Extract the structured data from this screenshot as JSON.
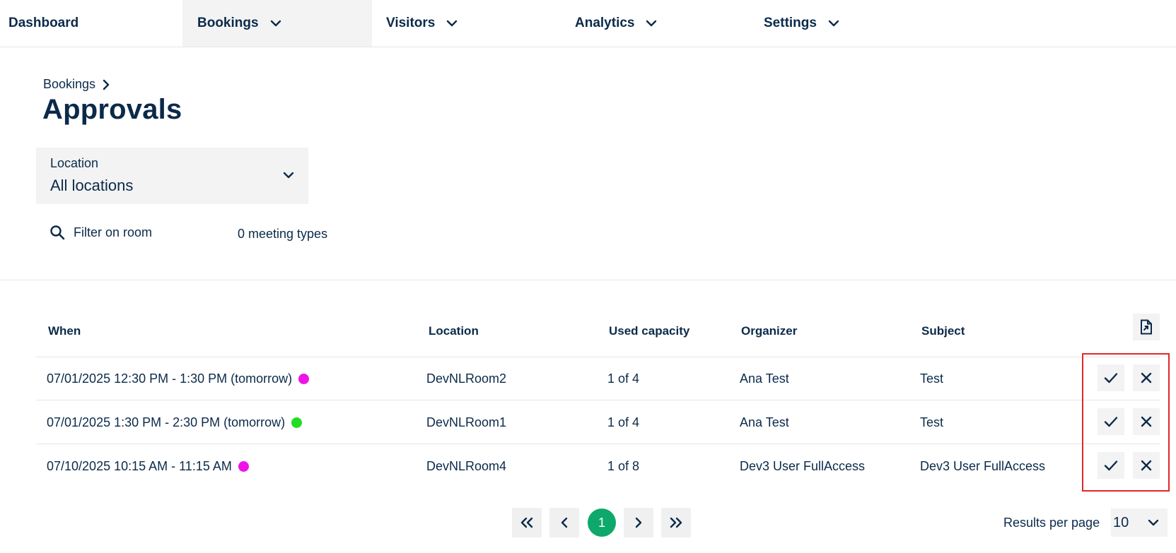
{
  "nav": {
    "items": [
      {
        "label": "Dashboard"
      },
      {
        "label": "Bookings"
      },
      {
        "label": "Visitors"
      },
      {
        "label": "Analytics"
      },
      {
        "label": "Settings"
      }
    ]
  },
  "breadcrumb": {
    "parent": "Bookings"
  },
  "page": {
    "title": "Approvals"
  },
  "filters": {
    "location_label": "Location",
    "location_value": "All locations",
    "room_filter": "Filter on room",
    "meeting_types": "0 meeting types"
  },
  "table": {
    "headers": [
      "When",
      "Location",
      "Used capacity",
      "Organizer",
      "Subject"
    ],
    "rows": [
      {
        "when": "07/01/2025 12:30 PM - 1:30 PM (tomorrow)",
        "status_color": "#ee14e6",
        "location": "DevNLRoom2",
        "capacity": "1 of 4",
        "organizer": "Ana Test",
        "subject": "Test"
      },
      {
        "when": "07/01/2025 1:30 PM - 2:30 PM (tomorrow)",
        "status_color": "#22dd22",
        "location": "DevNLRoom1",
        "capacity": "1 of 4",
        "organizer": "Ana Test",
        "subject": "Test"
      },
      {
        "when": "07/10/2025 10:15 AM - 11:15 AM",
        "status_color": "#ee14e6",
        "location": "DevNLRoom4",
        "capacity": "1 of 8",
        "organizer": "Dev3 User FullAccess",
        "subject": "Dev3 User FullAccess"
      }
    ]
  },
  "pagination": {
    "current_page": "1",
    "results_per_page_label": "Results per page",
    "results_per_page_value": "10"
  },
  "colors": {
    "primary_text": "#0b2a4a",
    "active_page": "#0ea86a",
    "highlight": "#e02828"
  }
}
